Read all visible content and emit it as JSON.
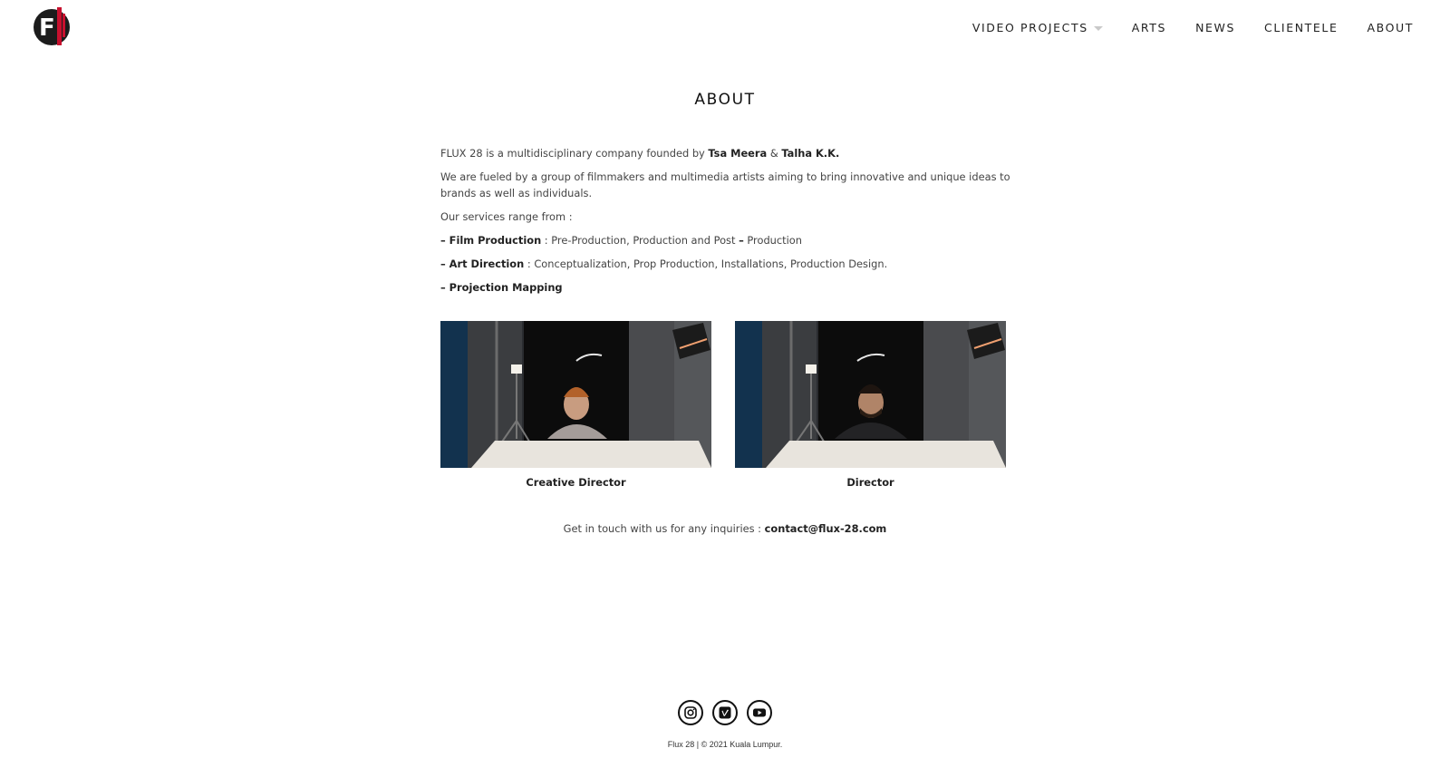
{
  "header": {
    "logo_text": "F",
    "nav": [
      {
        "label": "VIDEO PROJECTS",
        "has_dropdown": true
      },
      {
        "label": "ARTS"
      },
      {
        "label": "NEWS"
      },
      {
        "label": "CLIENTELE"
      },
      {
        "label": "ABOUT"
      }
    ]
  },
  "page": {
    "title": "ABOUT",
    "intro_prefix": "FLUX 28 is a multidisciplinary company founded by ",
    "founder1": "Tsa Meera",
    "amp": " & ",
    "founder2": "Talha K.K.",
    "para2": "We are fueled by a group of filmmakers and multimedia artists aiming to bring innovative and unique ideas to brands as well as individuals.",
    "services_intro": "Our services range from :",
    "services": [
      {
        "name": "– Film Production",
        "desc_a": " : Pre-Production, Production and Post ",
        "desc_dash": "–",
        "desc_b": " Production"
      },
      {
        "name": "– Art Direction",
        "desc": " : Conceptualization, Prop Production, Installations, Production Design."
      },
      {
        "name": "– Projection Mapping"
      }
    ],
    "team": [
      {
        "caption": "Creative Director"
      },
      {
        "caption": "Director"
      }
    ],
    "contact_prefix": "Get in touch with us for any inquiries : ",
    "contact_email": "contact@flux-28.com"
  },
  "footer": {
    "socials": [
      "instagram-icon",
      "vimeo-icon",
      "youtube-icon"
    ],
    "copyright": "Flux 28 | © 2021 Kuala Lumpur."
  },
  "colors": {
    "brand_red": "#c8102e",
    "text": "#444444",
    "nav_text": "#222222"
  }
}
